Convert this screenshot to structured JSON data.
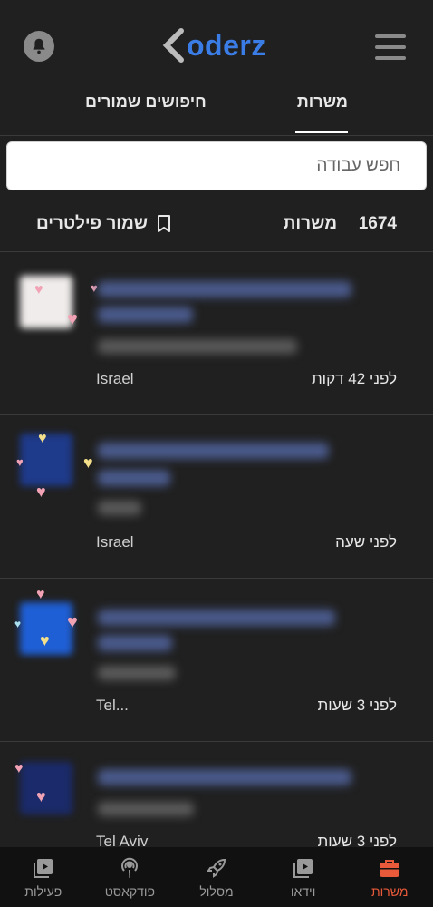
{
  "header": {
    "logo_text": "oderz",
    "bell_icon": "bell-icon",
    "menu_icon": "hamburger-icon"
  },
  "tabs": [
    {
      "label": "משרות",
      "active": true
    },
    {
      "label": "חיפושים שמורים",
      "active": false
    }
  ],
  "search": {
    "placeholder": "חפש עבודה"
  },
  "summary": {
    "count": "1674",
    "count_label": "משרות",
    "save_filters_label": "שמור פילטרים"
  },
  "jobs": [
    {
      "time": "לפני 42 דקות",
      "location": "Israel"
    },
    {
      "time": "לפני שעה",
      "location": "Israel"
    },
    {
      "time": "לפני 3 שעות",
      "location": "Tel..."
    },
    {
      "time": "לפני 3 שעות",
      "location": "Tel Aviv"
    }
  ],
  "bottom_nav": [
    {
      "label": "משרות",
      "icon": "briefcase-icon",
      "active": true
    },
    {
      "label": "וידאו",
      "icon": "video-icon",
      "active": false
    },
    {
      "label": "מסלול",
      "icon": "rocket-icon",
      "active": false
    },
    {
      "label": "פודקאסט",
      "icon": "podcast-icon",
      "active": false
    },
    {
      "label": "פעילות",
      "icon": "activity-icon",
      "active": false
    }
  ],
  "colors": {
    "accent": "#3b7de6",
    "active_nav": "#e85a3a",
    "background": "#202020"
  }
}
